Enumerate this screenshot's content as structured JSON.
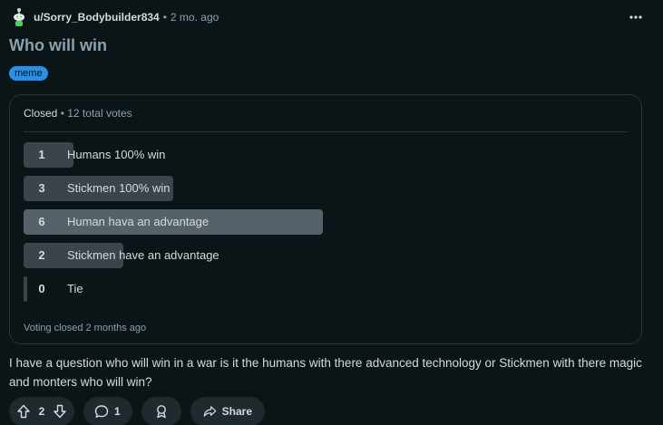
{
  "post": {
    "username": "u/Sorry_Bodybuilder834",
    "separator": "•",
    "time": "2 mo. ago",
    "more_icon": "more-horizontal-icon",
    "title": "Who will win",
    "flair": "meme",
    "flair_color": "#2a8fe6",
    "body": "I have a question who will win in a war is it the humans with there advanced technology or Stickmen with there magic and monters who will win?"
  },
  "poll": {
    "status": "Closed",
    "separator": "•",
    "total_votes": "12 total votes",
    "total": 12,
    "options": [
      {
        "count": "1",
        "votes": 1,
        "label": "Humans 100% win"
      },
      {
        "count": "3",
        "votes": 3,
        "label": "Stickmen 100% win"
      },
      {
        "count": "6",
        "votes": 6,
        "label": "Human hava an advantage"
      },
      {
        "count": "2",
        "votes": 2,
        "label": "Stickmen have an advantage"
      },
      {
        "count": "0",
        "votes": 0,
        "label": "Tie"
      }
    ],
    "footer": "Voting closed 2 months ago"
  },
  "actions": {
    "votes": "2",
    "comments": "1",
    "share_label": "Share"
  }
}
